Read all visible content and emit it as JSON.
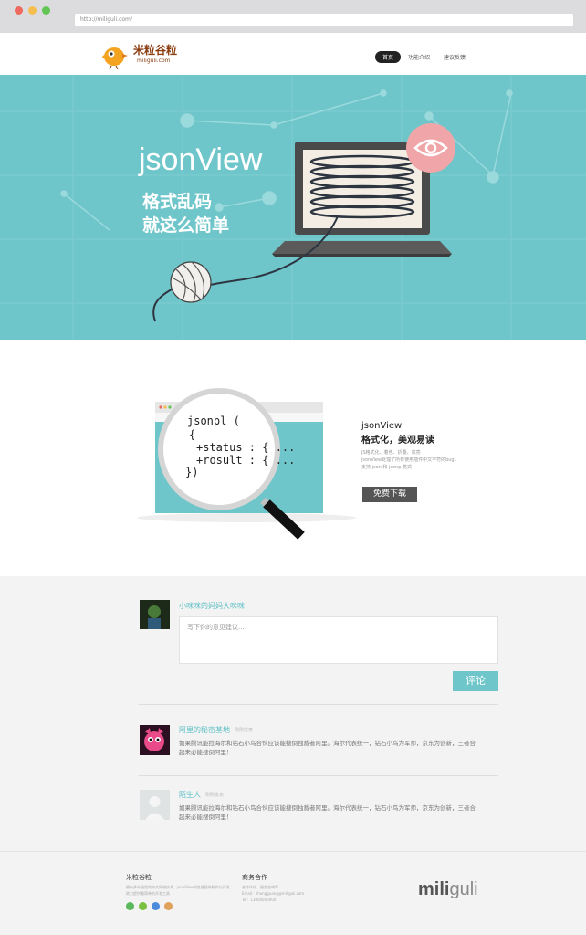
{
  "browser": {
    "url": "http://miliguli.com/",
    "dots": [
      "#ef6a5e",
      "#f5be4f",
      "#62c554"
    ]
  },
  "header": {
    "logo_text": "米粒谷粒",
    "logo_sub": "miliguli.com",
    "nav": [
      {
        "label": "首页",
        "active": true
      },
      {
        "label": "功能介绍",
        "active": false
      },
      {
        "label": "建议反馈",
        "active": false
      }
    ]
  },
  "hero": {
    "title": "jsonView",
    "subtitle_line1": "格式乱码",
    "subtitle_line2": "就这么简单"
  },
  "feature": {
    "code": [
      "jsonpl (",
      "{",
      "+status : { ...",
      "+rosult : { ...",
      "})"
    ],
    "title_line1": "jsonView",
    "title_line2": "格式化，美观易读",
    "desc_line1": "JS格式化、着色、折叠、高亮",
    "desc_line2": "jsonView处理了所有使用插件中文字符的bug。",
    "desc_line3": "支持 json 和 jsonp 格式",
    "download_label": "免费下载"
  },
  "comments": {
    "current_user": "小咪咪的妈妈大咪咪",
    "placeholder": "写下你的意见建议...",
    "submit_label": "评论",
    "items": [
      {
        "user": "阿里的秘密基地",
        "time": "刚刚发表",
        "text1": "如果腾讯能拉海尔和钻石小鸟合伙应该能搜倒独裁者阿里。海尔代表统一，钻石小鸟为军师，京东为创新，三者合",
        "text2": "起来必能搜倒阿里！"
      },
      {
        "user": "陌生人",
        "time": "刚刚发表",
        "text1": "如果腾讯能拉海尔和钻石小鸟合伙应该能搜倒独裁者阿里。海尔代表统一，钻石小鸟为军师，京东为创新，三者合",
        "text2": "起来必能搜倒阿里！"
      }
    ]
  },
  "footer": {
    "col1_title": "米粒谷粒",
    "col1_line1": "拥有多年经验的中文网络技术，jsonView浏览器插件制作与开发",
    "col1_line2": "致力提供最简单的开发工具",
    "col2_title": "商务合作",
    "col2_line1": "合作伙伴、服务咨询等",
    "col2_line2": "Email：zhongguang@miliguli.com",
    "col2_line3": "Tel：13800000000",
    "social_colors": [
      "#5cb85c",
      "#7ac143",
      "#4a8bdc",
      "#e0a15a"
    ],
    "brand_bold": "mili",
    "brand_light": "guli"
  }
}
